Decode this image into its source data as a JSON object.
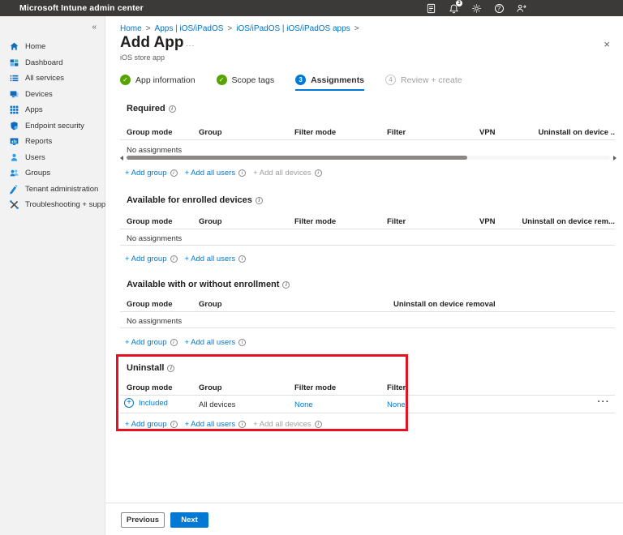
{
  "topbar": {
    "title": "Microsoft Intune admin center",
    "notification_count": "3",
    "icons": [
      "notepad-icon",
      "notifications-bell-icon",
      "settings-gear-icon",
      "help-icon",
      "feedback-icon"
    ]
  },
  "sidebar": {
    "items": [
      {
        "label": "Home",
        "icon": "home-icon"
      },
      {
        "label": "Dashboard",
        "icon": "dashboard-icon"
      },
      {
        "label": "All services",
        "icon": "all-services-icon"
      },
      {
        "label": "Devices",
        "icon": "devices-icon"
      },
      {
        "label": "Apps",
        "icon": "apps-icon"
      },
      {
        "label": "Endpoint security",
        "icon": "endpoint-security-shield-icon"
      },
      {
        "label": "Reports",
        "icon": "reports-icon"
      },
      {
        "label": "Users",
        "icon": "users-icon"
      },
      {
        "label": "Groups",
        "icon": "groups-icon"
      },
      {
        "label": "Tenant administration",
        "icon": "tenant-administration-icon"
      },
      {
        "label": "Troubleshooting + support",
        "icon": "troubleshooting-icon"
      }
    ]
  },
  "breadcrumb": {
    "separator": ">",
    "items": [
      "Home",
      "Apps | iOS/iPadOS",
      "iOS/iPadOS | iOS/iPadOS apps"
    ]
  },
  "page": {
    "title": "Add App",
    "subtitle": "iOS store app"
  },
  "wizard": {
    "steps": [
      {
        "label": "App information",
        "state": "complete"
      },
      {
        "label": "Scope tags",
        "state": "complete"
      },
      {
        "label": "Assignments",
        "state": "active",
        "number": "3"
      },
      {
        "label": "Review + create",
        "state": "upcoming",
        "number": "4"
      }
    ]
  },
  "sections": {
    "required": {
      "title": "Required",
      "headers": [
        "Group mode",
        "Group",
        "Filter mode",
        "Filter",
        "VPN",
        "Uninstall on device .."
      ],
      "empty_text": "No assignments",
      "links": {
        "add_group": "+ Add group",
        "add_all_users": "+ Add all users",
        "add_all_devices": "+ Add all devices"
      }
    },
    "available_enrolled": {
      "title": "Available for enrolled devices",
      "headers": [
        "Group mode",
        "Group",
        "Filter mode",
        "Filter",
        "VPN",
        "Uninstall on device rem..."
      ],
      "empty_text": "No assignments",
      "links": {
        "add_group": "+ Add group",
        "add_all_users": "+ Add all users"
      }
    },
    "available_without_enrollment": {
      "title": "Available with or without enrollment",
      "headers": [
        "Group mode",
        "Group",
        "Uninstall on device removal"
      ],
      "empty_text": "No assignments",
      "links": {
        "add_group": "+ Add group",
        "add_all_users": "+ Add all users"
      }
    },
    "uninstall": {
      "title": "Uninstall",
      "headers": [
        "Group mode",
        "Group",
        "Filter mode",
        "Filter"
      ],
      "row": {
        "group_mode": "Included",
        "group": "All devices",
        "filter_mode": "None",
        "filter": "None"
      },
      "links": {
        "add_group": "+ Add group",
        "add_all_users": "+ Add all users",
        "add_all_devices": "+ Add all devices"
      }
    }
  },
  "footer": {
    "previous_label": "Previous",
    "next_label": "Next"
  },
  "colors": {
    "accent": "#0078d4",
    "success": "#57a300",
    "highlight_box": "#e81123",
    "topbar_bg": "#3b3a39"
  }
}
